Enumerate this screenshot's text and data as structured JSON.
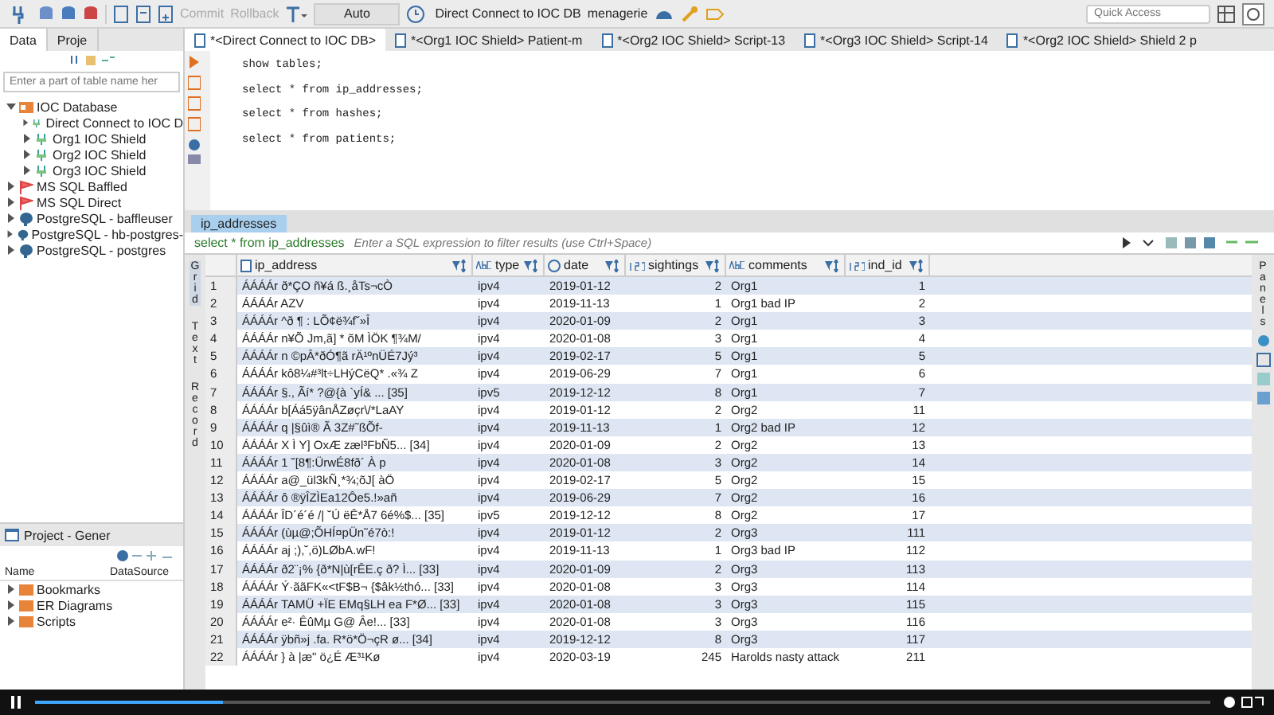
{
  "toolbar": {
    "commit": "Commit",
    "rollback": "Rollback",
    "commit_mode": "Auto",
    "connection": "Direct Connect to IOC DB",
    "schema": "menagerie",
    "quick_access": {
      "placeholder": "Quick Access"
    }
  },
  "left_tabs": [
    {
      "label": "Data",
      "selected": true
    },
    {
      "label": "Proje",
      "selected": false
    }
  ],
  "navigator": {
    "search": {
      "placeholder": "Enter a part of table name her"
    },
    "tree": [
      {
        "label": "IOC Database",
        "kind": "folder",
        "expanded": true,
        "children": [
          {
            "label": "Direct Connect to IOC D",
            "kind": "conn",
            "expanded": false
          },
          {
            "label": "Org1 IOC Shield",
            "kind": "conn",
            "expanded": false
          },
          {
            "label": "Org2 IOC Shield",
            "kind": "conn",
            "expanded": false
          },
          {
            "label": "Org3 IOC Shield",
            "kind": "conn",
            "expanded": false
          }
        ]
      },
      {
        "label": "MS SQL Baffled",
        "kind": "mssql",
        "expanded": false
      },
      {
        "label": "MS SQL Direct",
        "kind": "mssql",
        "expanded": false
      },
      {
        "label": "PostgreSQL - baffleuser",
        "kind": "pg",
        "expanded": false
      },
      {
        "label": "PostgreSQL - hb-postgres-",
        "kind": "pg",
        "expanded": false
      },
      {
        "label": "PostgreSQL - postgres",
        "kind": "pg",
        "expanded": false
      }
    ]
  },
  "project": {
    "title": "Project - Gener",
    "columns": [
      "Name",
      "DataSource"
    ],
    "items": [
      "Bookmarks",
      "ER Diagrams",
      "Scripts"
    ]
  },
  "editor_tabs": [
    {
      "label": "*<Direct Connect to IOC DB>",
      "selected": true
    },
    {
      "label": "*<Org1 IOC Shield> Patient-m",
      "selected": false
    },
    {
      "label": "*<Org2 IOC Shield> Script-13",
      "selected": false
    },
    {
      "label": "*<Org3 IOC Shield> Script-14",
      "selected": false
    },
    {
      "label": "*<Org2 IOC Shield> Shield 2 p",
      "selected": false
    }
  ],
  "sql": [
    "show tables;",
    "select * from ip_addresses;",
    "select * from hashes;",
    "select * from patients;"
  ],
  "results": {
    "tab": "ip_addresses",
    "query": "select * from ip_addresses",
    "filter": {
      "placeholder": "Enter a SQL expression to filter results (use Ctrl+Space)"
    },
    "side_tabs": [
      {
        "label": "Grid",
        "selected": true
      },
      {
        "label": "Text",
        "selected": false
      },
      {
        "label": "Record",
        "selected": false
      }
    ],
    "columns": [
      {
        "name": "ip_address",
        "kind": "bin"
      },
      {
        "name": "type",
        "kind": "text"
      },
      {
        "name": "date",
        "kind": "date"
      },
      {
        "name": "sightings",
        "kind": "num"
      },
      {
        "name": "comments",
        "kind": "text"
      },
      {
        "name": "ind_id",
        "kind": "num"
      }
    ],
    "rows": [
      {
        "number": "1",
        "cells": [
          "ÁÁÁÁr  ð*ÇO ñ¥á ß.¸åTs¬cÒ",
          "ipv4",
          "2019-01-12",
          "2",
          "Org1",
          "1"
        ]
      },
      {
        "number": "2",
        "cells": [
          "ÁÁÁÁr  AZV",
          "ipv4",
          "2019-11-13",
          "1",
          "Org1 bad IP",
          "2"
        ]
      },
      {
        "number": "3",
        "cells": [
          "ÁÁÁÁr  ^ð ¶ : LÕ¢ë¾f˘»Î",
          "ipv4",
          "2020-01-09",
          "2",
          "Org1",
          "3"
        ]
      },
      {
        "number": "4",
        "cells": [
          "ÁÁÁÁr  n¥Õ Jm,ã] * õM ÌÖK ¶¾M/",
          "ipv4",
          "2020-01-08",
          "3",
          "Org1",
          "4"
        ]
      },
      {
        "number": "5",
        "cells": [
          "ÁÁÁÁr  n ©pÂ*ðÓ¶ã rÄ¹ºnÜÉ7Jý³",
          "ipv4",
          "2019-02-17",
          "5",
          "Org1",
          "5"
        ]
      },
      {
        "number": "6",
        "cells": [
          "ÁÁÁÁr  kô8¼#³lt÷LHýCëQ* .«¾ Z",
          "ipv4",
          "2019-06-29",
          "7",
          "Org1",
          "6"
        ]
      },
      {
        "number": "7",
        "cells": [
          "ÁÁÁÁr  §.,  Ãí*  ?@{à `yÍ& ... [35]",
          "ipv5",
          "2019-12-12",
          "8",
          "Org1",
          "7"
        ]
      },
      {
        "number": "8",
        "cells": [
          "ÁÁÁÁr  b[Áá5ÿânÅZøçr\\/*LaAY",
          "ipv4",
          "2019-01-12",
          "2",
          "Org2",
          "11"
        ]
      },
      {
        "number": "9",
        "cells": [
          "ÁÁÁÁr  q |§ûì®  Ã 3Z#˜ßÕf-",
          "ipv4",
          "2019-11-13",
          "1",
          "Org2 bad IP",
          "12"
        ]
      },
      {
        "number": "10",
        "cells": [
          "ÁÁÁÁr   X Ì Y]  OxÆ zæl³FbÑ5... [34]",
          "ipv4",
          "2020-01-09",
          "2",
          "Org2",
          "13"
        ]
      },
      {
        "number": "11",
        "cells": [
          "ÁÁÁÁr  1 ˘[8¶:ÜrwÉ8fð´ À p",
          "ipv4",
          "2020-01-08",
          "3",
          "Org2",
          "14"
        ]
      },
      {
        "number": "12",
        "cells": [
          "ÁÁÁÁr  a@_ül3kÑ¸*¾;õJ[ àÖ",
          "ipv4",
          "2019-02-17",
          "5",
          "Org2",
          "15"
        ]
      },
      {
        "number": "13",
        "cells": [
          "ÁÁÁÁr   ô ®ÿÎZÌEa12Ôe5.!»añ",
          "ipv4",
          "2019-06-29",
          "7",
          "Org2",
          "16"
        ]
      },
      {
        "number": "14",
        "cells": [
          "ÁÁÁÁr  ÎD´é´é /| ˘Ú ëÊ*Å7 6é%$... [35]",
          "ipv5",
          "2019-12-12",
          "8",
          "Org2",
          "17"
        ]
      },
      {
        "number": "15",
        "cells": [
          "ÁÁÁÁr  (ùµ@;ÕHÍ¤pÜn˜é7ò:!",
          "ipv4",
          "2019-01-12",
          "2",
          "Org3",
          "111"
        ]
      },
      {
        "number": "16",
        "cells": [
          "ÁÁÁÁr  aj ;),˘,ö)LØbA.wF!",
          "ipv4",
          "2019-11-13",
          "1",
          "Org3 bad IP",
          "112"
        ]
      },
      {
        "number": "17",
        "cells": [
          "ÁÁÁÁr  ð2¨¡% {ð*N|ù[rÊE.ç ð? Ì... [33]",
          "ipv4",
          "2020-01-09",
          "2",
          "Org3",
          "113"
        ]
      },
      {
        "number": "18",
        "cells": [
          "ÁÁÁÁr  Ý·ããFK«<tF$B¬ {$âk½thó... [33]",
          "ipv4",
          "2020-01-08",
          "3",
          "Org3",
          "114"
        ]
      },
      {
        "number": "19",
        "cells": [
          "ÁÁÁÁr  TAMÜ +ÏE EMq§LH ea  F*Ø... [33]",
          "ipv4",
          "2020-01-08",
          "3",
          "Org3",
          "115"
        ]
      },
      {
        "number": "20",
        "cells": [
          "ÁÁÁÁr  e²·   ÊûMµ G@ Âe!... [33]",
          "ipv4",
          "2020-01-08",
          "3",
          "Org3",
          "116"
        ]
      },
      {
        "number": "21",
        "cells": [
          "ÁÁÁÁr  ÿbñ»j .fa. R*ö*Ö¬çR ø... [34]",
          "ipv4",
          "2019-12-12",
          "8",
          "Org3",
          "117"
        ]
      },
      {
        "number": "22",
        "cells": [
          "ÁÁÁÁr  } à |æ\" ö¿É Æ³¹Kø",
          "ipv4",
          "2020-03-19",
          "245",
          "Harolds nasty attack",
          "211"
        ]
      }
    ]
  },
  "right_panel": {
    "label": "Panels"
  },
  "player": {
    "progress": {
      "level": 0.16
    }
  }
}
